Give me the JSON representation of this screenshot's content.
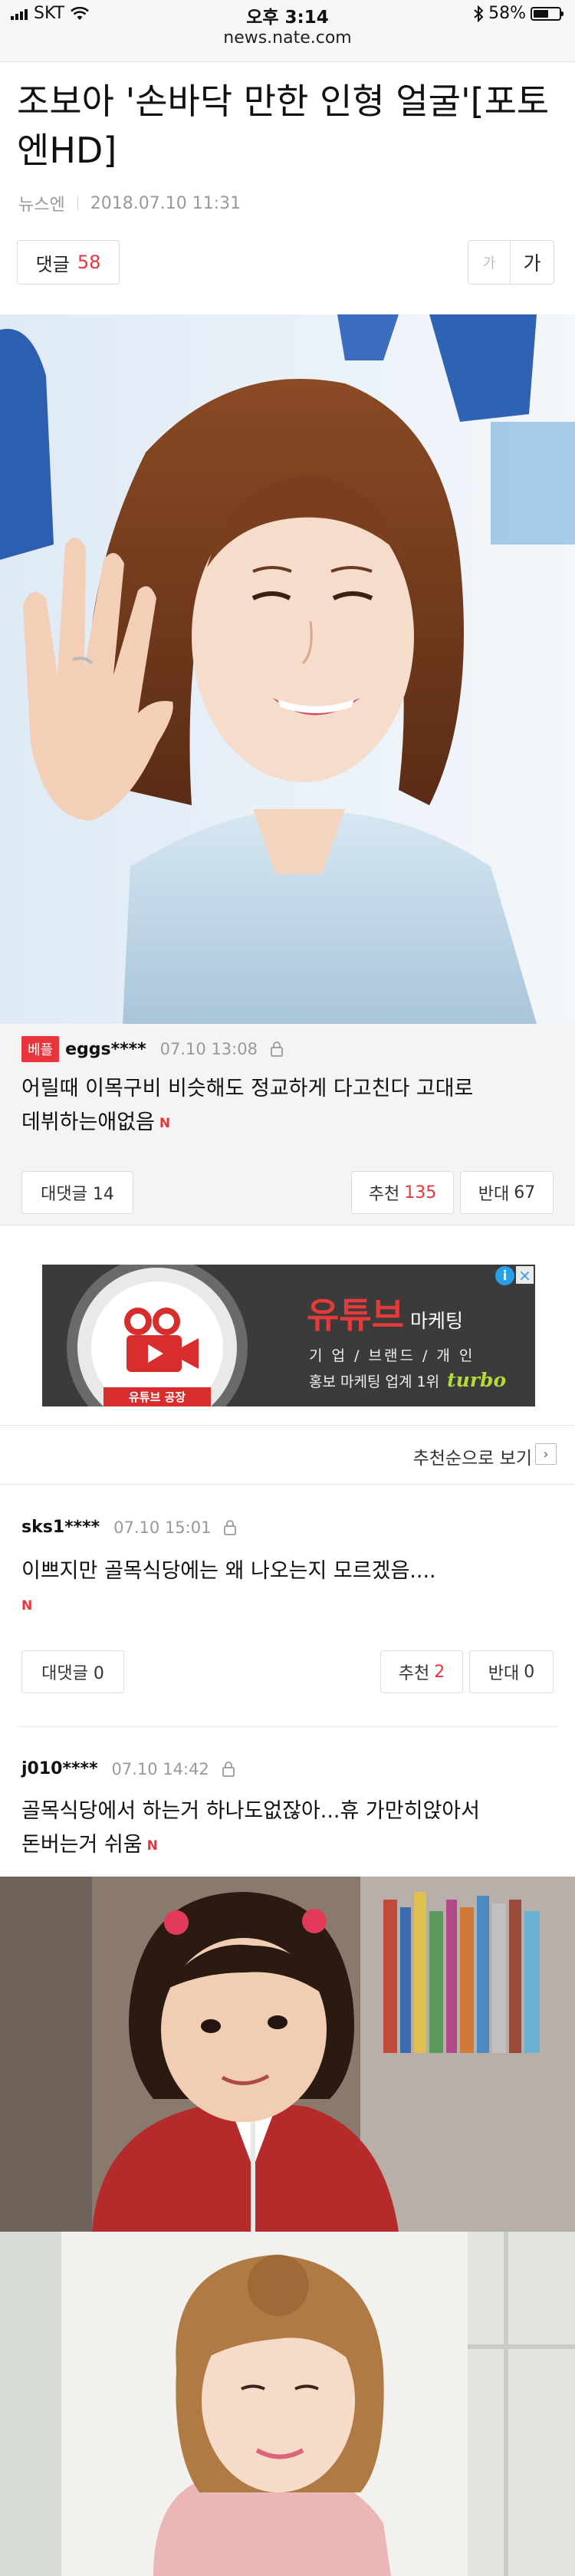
{
  "status_bar": {
    "carrier": "SKT",
    "time": "오후 3:14",
    "url": "news.nate.com",
    "battery_percent": "58%",
    "battery_level": 0.58,
    "icons": [
      "signal-icon",
      "wifi-icon",
      "bluetooth-icon",
      "battery-icon"
    ]
  },
  "article": {
    "title": "조보아 '손바닥 만한 인형 얼굴'[포토엔HD]",
    "source": "뉴스엔",
    "date": "2018.07.10 11:31",
    "comment_label": "댓글",
    "comment_count": "58",
    "font_small_label": "가",
    "font_large_label": "가"
  },
  "best_comment": {
    "badge": "베플",
    "user": "eggs****",
    "time": "07.10 13:08",
    "text_line1": "어릴때 이목구비 비슷해도 정교하게 다고친다 고대로",
    "text_line2": "데뷔하는애없음",
    "new_marker": "N",
    "reply_label": "대댓글 14",
    "like_label": "추천",
    "like_count": "135",
    "dislike_label": "반대",
    "dislike_count": "67"
  },
  "ad": {
    "headline": "유튜브",
    "headline_suffix": "마케팅",
    "line1": "기 업 / 브랜드 / 개 인",
    "line2": "홍보 마케팅 업계 1위",
    "brand": "turbo",
    "sign": "유튜브 공장"
  },
  "sort": {
    "label": "추천순으로 보기"
  },
  "comments": [
    {
      "user": "sks1****",
      "time": "07.10 15:01",
      "text_line1": "이쁘지만 골목식당에는 왜 나오는지 모르겠음....",
      "new_marker": "N",
      "reply_label": "대댓글 0",
      "like_label": "추천",
      "like_count": "2",
      "dislike_label": "반대",
      "dislike_count": "0"
    },
    {
      "user": "j010****",
      "time": "07.10 14:42",
      "text_line1": "골목식당에서 하는거 하나도없잖아...휴 가만히앉아서",
      "text_line2": "돈버는거 쉬움",
      "new_marker": "N"
    }
  ],
  "colors": {
    "accent_red": "#e8353b",
    "meta_gray": "#999999",
    "best_bg": "#f4f4f4"
  }
}
